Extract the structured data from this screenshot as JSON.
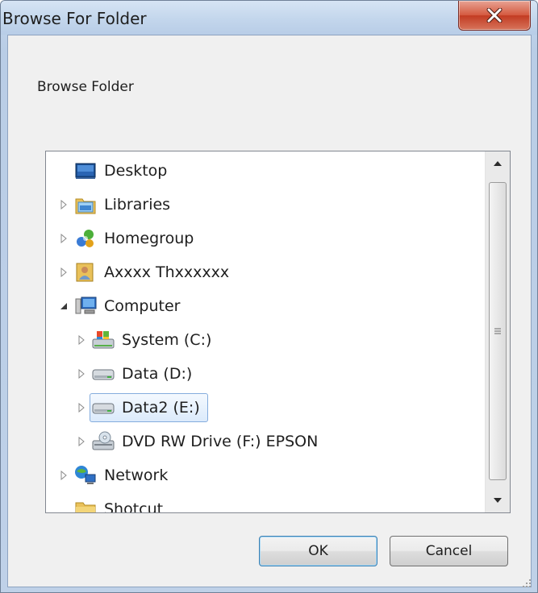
{
  "window": {
    "title": "Browse For Folder",
    "description": "Browse Folder"
  },
  "tree": {
    "items": [
      {
        "label": "Desktop",
        "icon": "desktop-icon",
        "expander": "none",
        "level": 0
      },
      {
        "label": "Libraries",
        "icon": "libraries-icon",
        "expander": "collapsed",
        "level": 0
      },
      {
        "label": "Homegroup",
        "icon": "homegroup-icon",
        "expander": "collapsed",
        "level": 0
      },
      {
        "label": "Axxxx  Thxxxxxx",
        "icon": "user-folder-icon",
        "expander": "collapsed",
        "level": 0
      },
      {
        "label": "Computer",
        "icon": "computer-icon",
        "expander": "expanded",
        "level": 0
      },
      {
        "label": "System (C:)",
        "icon": "system-drive-icon",
        "expander": "collapsed",
        "level": 1
      },
      {
        "label": "Data (D:)",
        "icon": "hard-drive-icon",
        "expander": "collapsed",
        "level": 1
      },
      {
        "label": "Data2 (E:)",
        "icon": "hard-drive-icon",
        "expander": "collapsed",
        "level": 1,
        "selected": true
      },
      {
        "label": "DVD RW Drive (F:) EPSON",
        "icon": "dvd-drive-icon",
        "expander": "collapsed",
        "level": 1
      },
      {
        "label": "Network",
        "icon": "network-icon",
        "expander": "collapsed",
        "level": 0
      },
      {
        "label": "Shotcut",
        "icon": "folder-icon",
        "expander": "none",
        "level": 0
      }
    ]
  },
  "buttons": {
    "ok": "OK",
    "cancel": "Cancel"
  }
}
